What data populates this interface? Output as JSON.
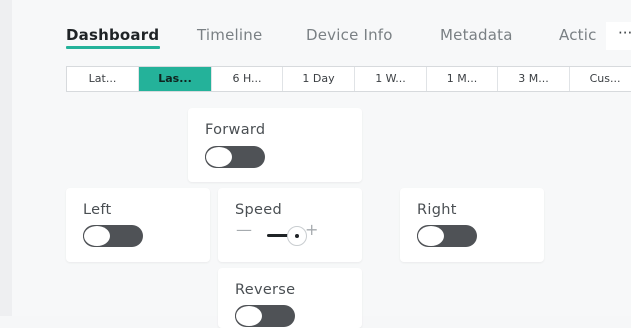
{
  "tabs": [
    {
      "label": "Dashboard",
      "active": true
    },
    {
      "label": "Timeline",
      "active": false
    },
    {
      "label": "Device Info",
      "active": false
    },
    {
      "label": "Metadata",
      "active": false
    },
    {
      "label": "Actic",
      "active": false
    }
  ],
  "tabs_more": "···",
  "time_ranges": [
    {
      "label": "Lat...",
      "active": false
    },
    {
      "label": "Las...",
      "active": true
    },
    {
      "label": "6 H...",
      "active": false
    },
    {
      "label": "1 Day",
      "active": false
    },
    {
      "label": "1 W...",
      "active": false
    },
    {
      "label": "1 M...",
      "active": false
    },
    {
      "label": "3 M...",
      "active": false
    },
    {
      "label": "Cus...",
      "active": false
    }
  ],
  "widgets": {
    "forward": {
      "title": "Forward",
      "state": "off"
    },
    "left": {
      "title": "Left",
      "state": "off"
    },
    "speed": {
      "title": "Speed",
      "minus": "—",
      "plus": "+"
    },
    "right": {
      "title": "Right",
      "state": "off"
    },
    "reverse": {
      "title": "Reverse",
      "state": "off"
    }
  },
  "colors": {
    "accent": "#24b29a",
    "switch_off": "#4f5256"
  }
}
